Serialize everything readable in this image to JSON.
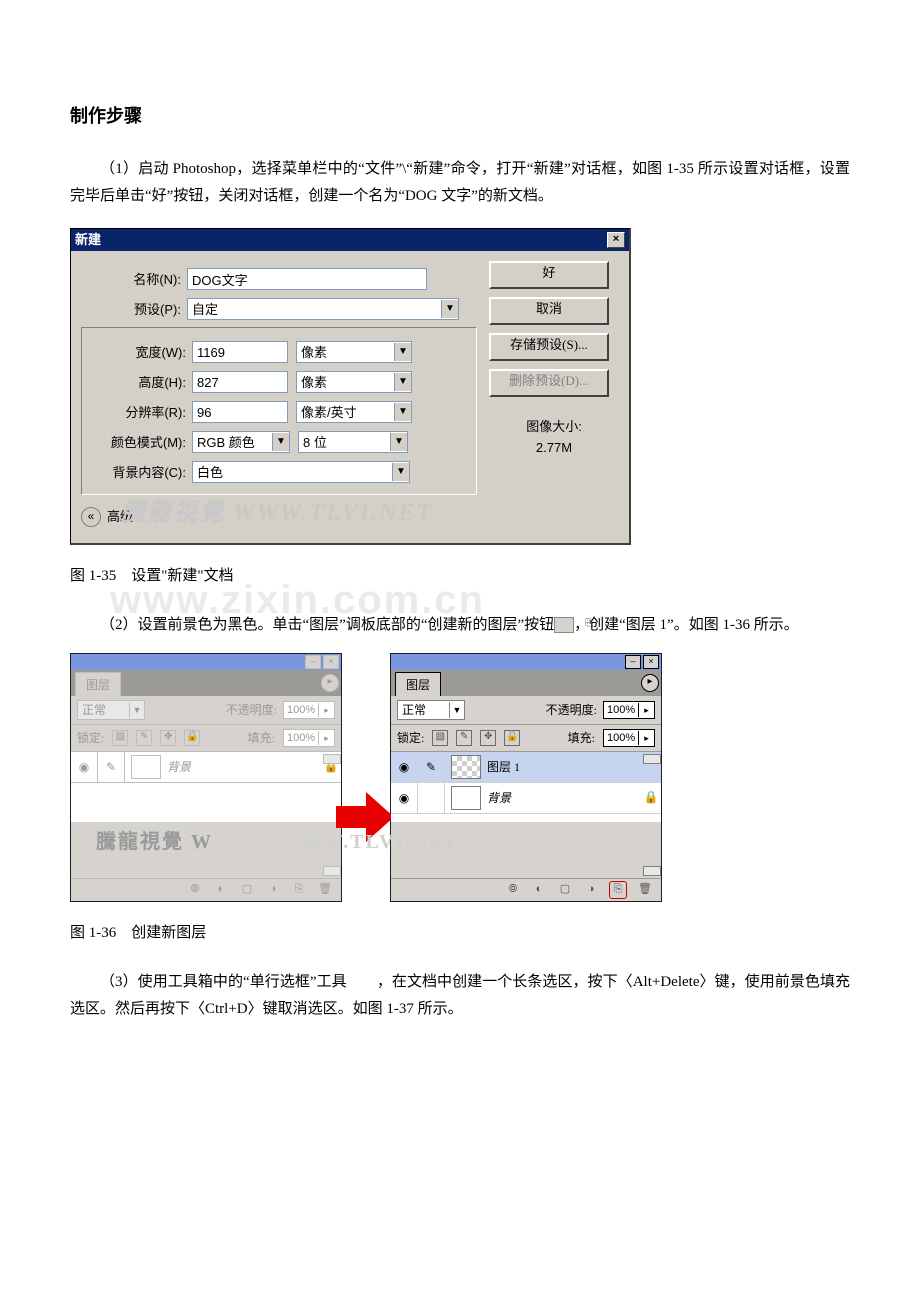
{
  "heading": "制作步骤",
  "para1": "（1）启动 Photoshop，选择菜单栏中的“文件”\\“新建”命令，打开“新建”对话框，如图 1-35 所示设置对话框，设置完毕后单击“好”按钮，关闭对话框，创建一个名为“DOG 文字”的新文档。",
  "dialog": {
    "title": "新建",
    "name_label": "名称(N):",
    "name_value": "DOG文字",
    "preset_label": "预设(P):",
    "preset_value": "自定",
    "width_label": "宽度(W):",
    "width_value": "1169",
    "width_unit": "像素",
    "height_label": "高度(H):",
    "height_value": "827",
    "height_unit": "像素",
    "res_label": "分辨率(R):",
    "res_value": "96",
    "res_unit": "像素/英寸",
    "mode_label": "颜色模式(M):",
    "mode_value": "RGB 颜色",
    "mode_bits": "8 位",
    "bg_label": "背景内容(C):",
    "bg_value": "白色",
    "btn_ok": "好",
    "btn_cancel": "取消",
    "btn_save": "存储预设(S)...",
    "btn_del": "删除预设(D)...",
    "size_label": "图像大小:",
    "size_value": "2.77M",
    "advanced": "高级",
    "watermark": "騰龍視覺 WWW.TLVI.NET"
  },
  "caption1": "图 1-35　设置\"新建\"文档",
  "para2_a": "（2）设置前景色为黑色。单击“图层”调板底部的“创建新的图层”按钮",
  "para2_b": "，创建“图层  1”。如图 1-36 所示。",
  "panel": {
    "tab": "图层",
    "blend": "正常",
    "opacity_label": "不透明度:",
    "opacity": "100%",
    "lock_label": "锁定:",
    "fill_label": "填充:",
    "fill": "100%",
    "bg_layer": "背景",
    "layer1": "图层 1",
    "watermark": "騰龍視覺 WWW.TLVI.NET"
  },
  "caption2": "图 1-36　创建新图层",
  "para3": "（3）使用工具箱中的“单行选框”工具　　，在文档中创建一个长条选区，按下〈Alt+Delete〉键，使用前景色填充选区。然后再按下〈Ctrl+D〉键取消选区。如图 1-37 所示。"
}
